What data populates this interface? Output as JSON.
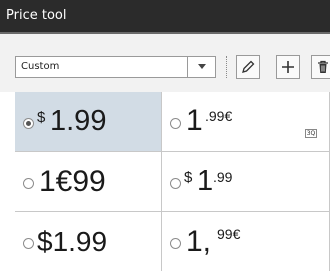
{
  "window": {
    "title": "Price tool"
  },
  "toolbar": {
    "format_select": {
      "value": "Custom"
    },
    "icons": [
      "pencil-icon",
      "plus-icon",
      "trash-icon"
    ]
  },
  "formats": [
    {
      "prefix": "$",
      "main": "1.99",
      "suffix": "",
      "selected": true
    },
    {
      "prefix": "",
      "main": "1",
      "suffix": ".99€",
      "selected": false
    },
    {
      "prefix": "",
      "main": "1€99",
      "suffix": "",
      "selected": false
    },
    {
      "prefix": "$",
      "main": "1",
      "suffix": ".99",
      "selected": false
    },
    {
      "prefix": "",
      "main": "$1.99",
      "suffix": "",
      "selected": false
    },
    {
      "prefix": "",
      "main": "1,",
      "suffix": "99€",
      "selected": false
    }
  ],
  "badge": {
    "label": "3Q"
  }
}
